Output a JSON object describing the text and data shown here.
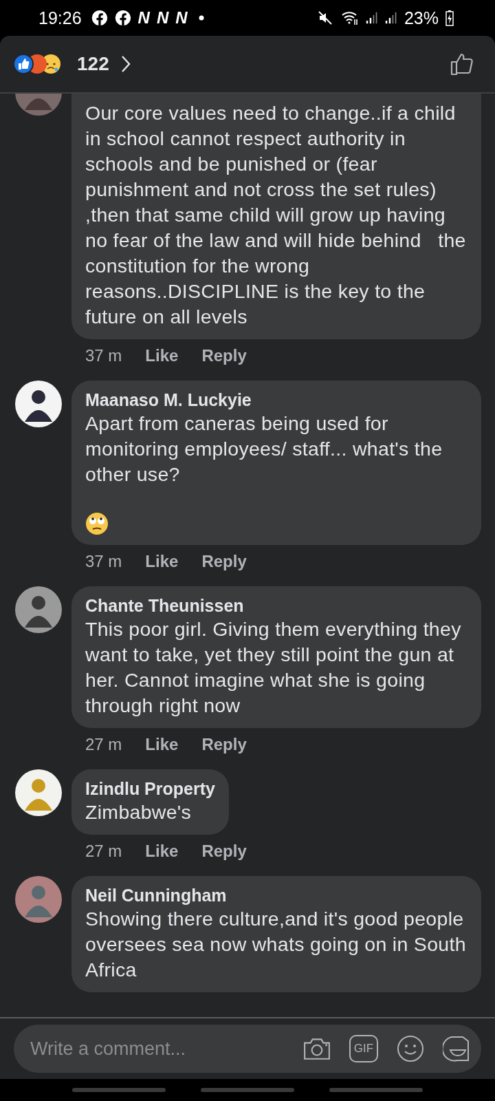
{
  "status_bar": {
    "time": "19:26",
    "notifications": [
      {
        "kind": "facebook"
      },
      {
        "kind": "facebook"
      },
      {
        "kind": "letter",
        "label": "N"
      },
      {
        "kind": "letter",
        "label": "N"
      },
      {
        "kind": "letter",
        "label": "N"
      },
      {
        "kind": "dot"
      }
    ],
    "battery": "23%"
  },
  "header": {
    "reaction_count": "122"
  },
  "comments": [
    {
      "text": "Our core values need to change..if a child in school cannot respect authority in schools and be punished or (fear punishment and not cross the set rules) ,then that same child will grow up having no fear of the law and will hide behind   the constitution for the wrong reasons..DISCIPLINE is the key to the future on all levels",
      "has_emoji": false,
      "time": "37 m",
      "like": "Like",
      "reply": "Reply"
    },
    {
      "name": "Maanaso M. Luckyie",
      "text": "Apart from caneras being used for monitoring employees/ staff... what's the other use?",
      "has_emoji": true,
      "time": "37 m",
      "like": "Like",
      "reply": "Reply"
    },
    {
      "name": "Chante Theunissen",
      "text": "This poor girl. Giving them everything they want to take, yet they still point the gun at her. Cannot imagine what she is going through right now",
      "has_emoji": false,
      "time": "27 m",
      "like": "Like",
      "reply": "Reply"
    },
    {
      "name": "Izindlu Property",
      "text": "Zimbabwe's",
      "has_emoji": false,
      "time": "27 m",
      "like": "Like",
      "reply": "Reply"
    },
    {
      "name": "Neil Cunningham",
      "text": "Showing there culture,and it's good people oversees sea now whats going on in South Africa",
      "has_emoji": false
    }
  ],
  "composer": {
    "placeholder": "Write a comment...",
    "gif_label": "GIF"
  }
}
